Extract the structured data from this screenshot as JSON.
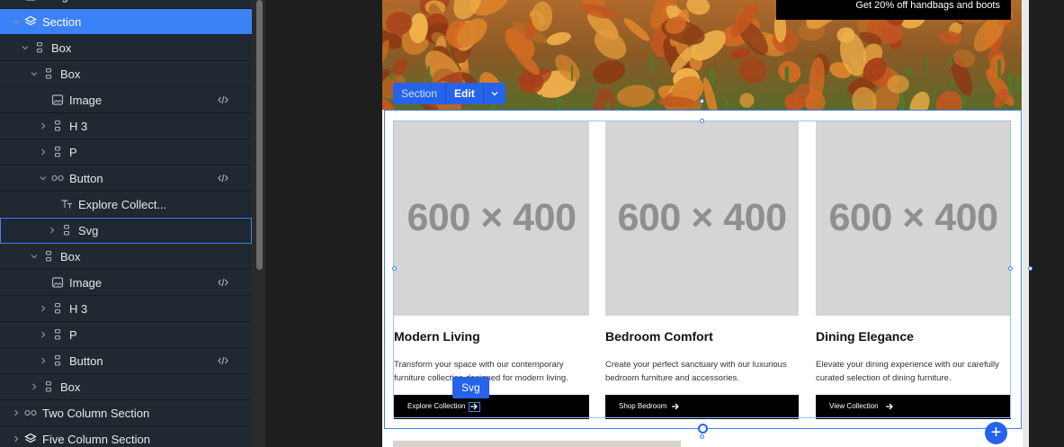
{
  "layers": [
    {
      "label": "Image",
      "icon": "image-icon",
      "level": 0,
      "chevron": "none",
      "code": false,
      "partial": true
    },
    {
      "label": "Section",
      "icon": "layers-icon",
      "level": 0,
      "chevron": "open",
      "code": false,
      "selected": true
    },
    {
      "label": "Box",
      "icon": "box-icon",
      "level": 1,
      "chevron": "open",
      "code": false
    },
    {
      "label": "Box",
      "icon": "box-icon",
      "level": 2,
      "chevron": "open",
      "code": false
    },
    {
      "label": "Image",
      "icon": "image-icon",
      "level": 3,
      "chevron": "none",
      "code": true
    },
    {
      "label": "H 3",
      "icon": "box-icon",
      "level": 3,
      "chevron": "closed",
      "code": false
    },
    {
      "label": "P",
      "icon": "box-icon",
      "level": 3,
      "chevron": "closed",
      "code": false
    },
    {
      "label": "Button",
      "icon": "link-icon",
      "level": 3,
      "chevron": "open",
      "code": true
    },
    {
      "label": "Explore Collect...",
      "icon": "text-icon",
      "level": 4,
      "chevron": "none",
      "code": false
    },
    {
      "label": "Svg",
      "icon": "box-icon",
      "level": 4,
      "chevron": "closed",
      "code": false,
      "hovered": true
    },
    {
      "label": "Box",
      "icon": "box-icon",
      "level": 2,
      "chevron": "open",
      "code": false
    },
    {
      "label": "Image",
      "icon": "image-icon",
      "level": 3,
      "chevron": "none",
      "code": true
    },
    {
      "label": "H 3",
      "icon": "box-icon",
      "level": 3,
      "chevron": "closed",
      "code": false
    },
    {
      "label": "P",
      "icon": "box-icon",
      "level": 3,
      "chevron": "closed",
      "code": false
    },
    {
      "label": "Button",
      "icon": "box-icon",
      "level": 3,
      "chevron": "closed",
      "code": true
    },
    {
      "label": "Box",
      "icon": "box-icon",
      "level": 2,
      "chevron": "closed",
      "code": false
    },
    {
      "label": "Two Column Section",
      "icon": "link-icon",
      "level": 0,
      "chevron": "closed",
      "code": false
    },
    {
      "label": "Five Column Section",
      "icon": "layers-icon",
      "level": 0,
      "chevron": "closed",
      "code": false
    }
  ],
  "hero": {
    "promo_text": "Get 20% off handbags and boots"
  },
  "toolbar": {
    "section_label": "Section",
    "edit_label": "Edit",
    "svg_tag": "Svg"
  },
  "cards": [
    {
      "image_text": "600 × 400",
      "title": "Modern Living",
      "desc": "Transform your space with our contemporary furniture collection designed for modern living.",
      "button": "Explore Collection"
    },
    {
      "image_text": "600 × 400",
      "title": "Bedroom Comfort",
      "desc": "Create your perfect sanctuary with our luxurious bedroom furniture and accessories.",
      "button": "Shop Bedroom"
    },
    {
      "image_text": "600 × 400",
      "title": "Dining Elegance",
      "desc": "Elevate your dining experience with our carefully curated selection of dining furniture.",
      "button": "View Collection"
    }
  ],
  "add_button": "+",
  "colors": {
    "accent": "#3b82f6",
    "panel": "#202831",
    "selected_row": "#3b82f6"
  }
}
